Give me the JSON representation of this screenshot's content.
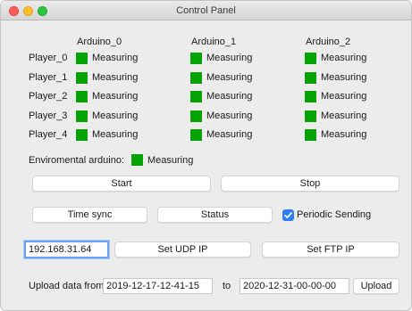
{
  "window": {
    "title": "Control Panel"
  },
  "columns": [
    "Arduino_0",
    "Arduino_1",
    "Arduino_2"
  ],
  "rows": [
    {
      "label": "Player_0",
      "status": [
        "Measuring",
        "Measuring",
        "Measuring"
      ]
    },
    {
      "label": "Player_1",
      "status": [
        "Measuring",
        "Measuring",
        "Measuring"
      ]
    },
    {
      "label": "Player_2",
      "status": [
        "Measuring",
        "Measuring",
        "Measuring"
      ]
    },
    {
      "label": "Player_3",
      "status": [
        "Measuring",
        "Measuring",
        "Measuring"
      ]
    },
    {
      "label": "Player_4",
      "status": [
        "Measuring",
        "Measuring",
        "Measuring"
      ]
    }
  ],
  "environmental": {
    "label": "Enviromental arduino:",
    "status": "Measuring"
  },
  "colors": {
    "indicator": "#05a305",
    "accent": "#2f7df6"
  },
  "buttons": {
    "start": "Start",
    "stop": "Stop",
    "time_sync": "Time sync",
    "status": "Status",
    "set_udp_ip": "Set UDP IP",
    "set_ftp_ip": "Set FTP IP",
    "upload": "Upload"
  },
  "periodic": {
    "label": "Periodic Sending",
    "checked": true
  },
  "ip": {
    "value": "192.168.31.64"
  },
  "upload": {
    "from_label": "Upload data from",
    "from_value": "2019-12-17-12-41-15",
    "to_label": "to",
    "to_value": "2020-12-31-00-00-00"
  }
}
